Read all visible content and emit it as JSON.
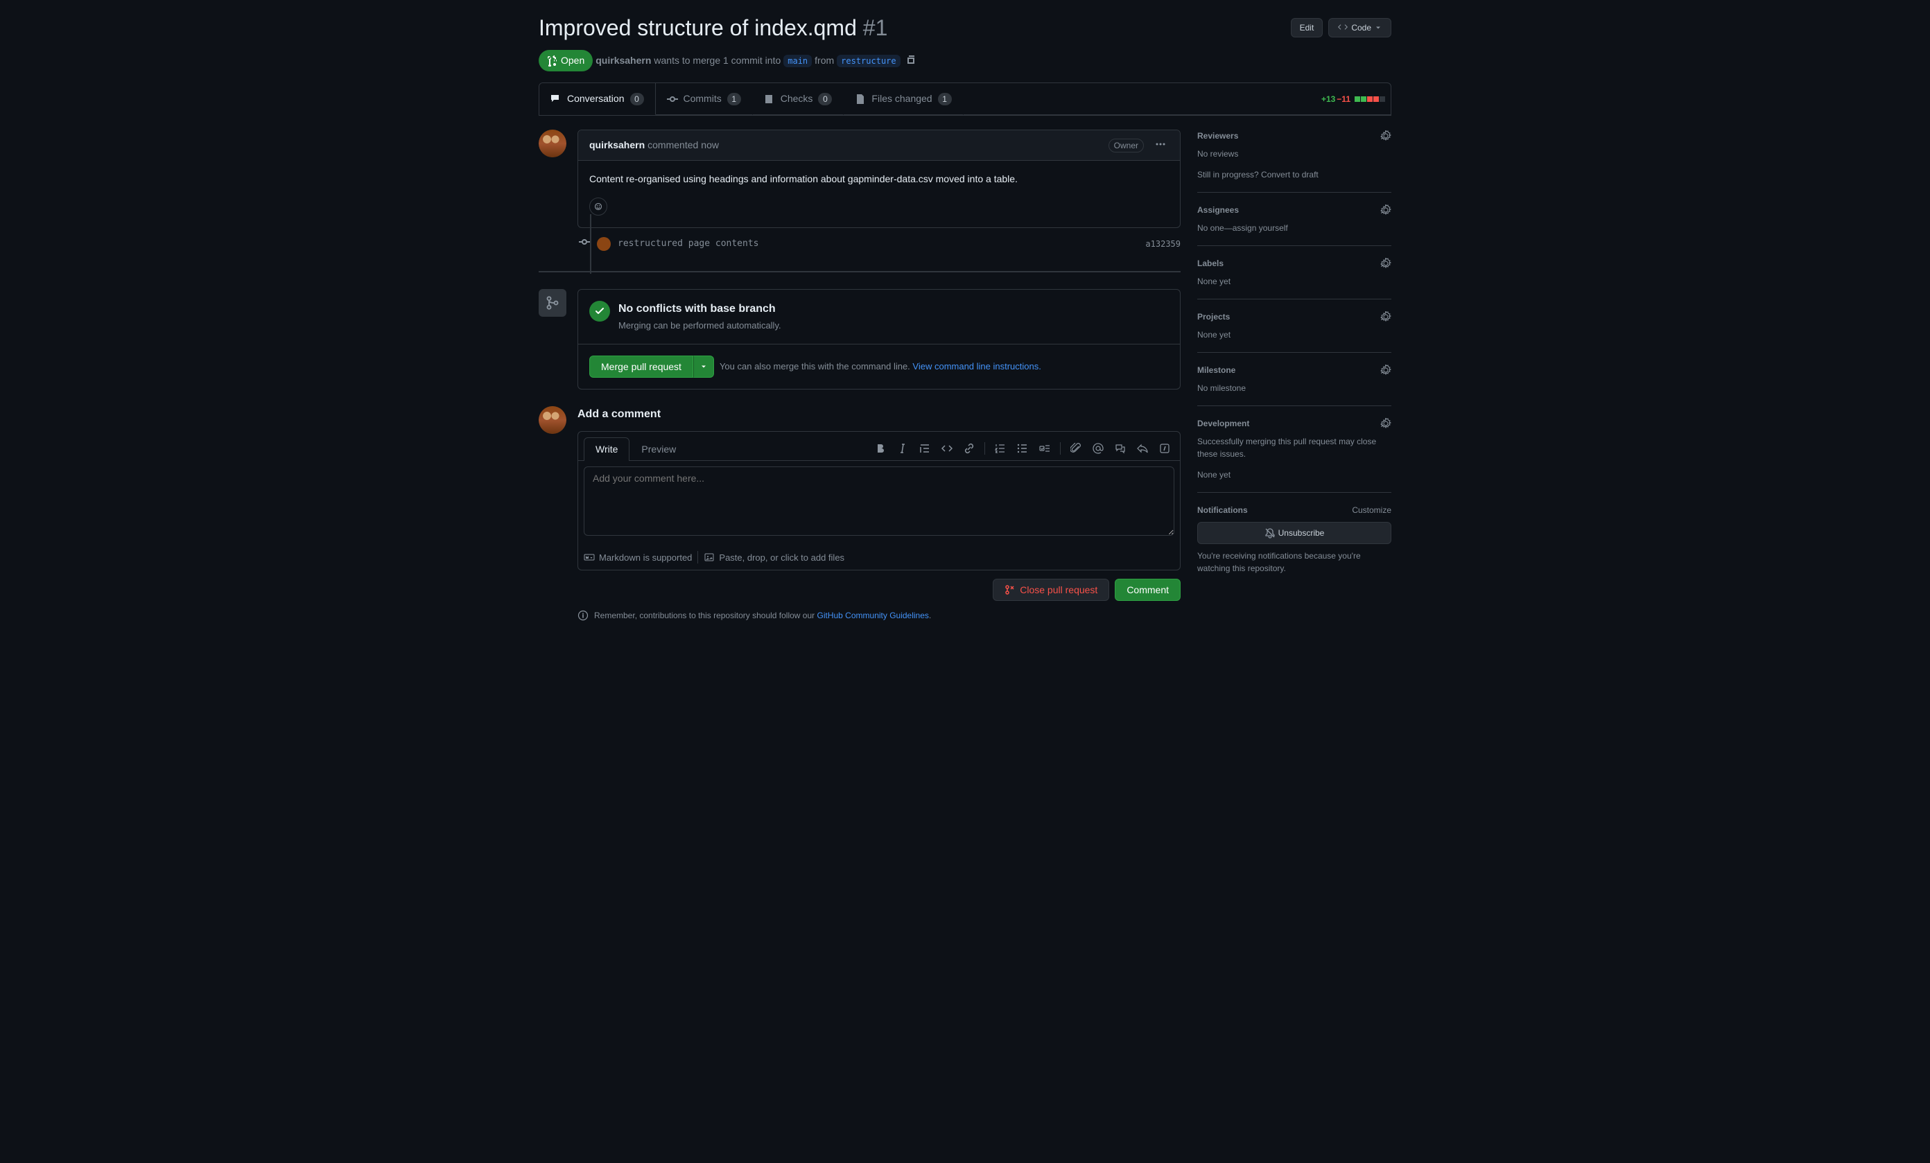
{
  "header": {
    "title": "Improved structure of index.qmd",
    "number": "#1",
    "edit": "Edit",
    "code": "Code",
    "state": "Open",
    "author": "quirksahern",
    "wants": "wants to merge 1 commit into",
    "base": "main",
    "from": "from",
    "compare": "restructure"
  },
  "tabs": {
    "conversation": {
      "label": "Conversation",
      "count": "0"
    },
    "commits": {
      "label": "Commits",
      "count": "1"
    },
    "checks": {
      "label": "Checks",
      "count": "0"
    },
    "files": {
      "label": "Files changed",
      "count": "1"
    }
  },
  "diffstat": {
    "add": "+13",
    "del": "−11"
  },
  "comment": {
    "author": "quirksahern",
    "action": "commented",
    "time": "now",
    "role": "Owner",
    "body": "Content re-organised using headings and information about gapminder-data.csv moved into a table."
  },
  "commit": {
    "msg": "restructured page contents",
    "sha": "a132359"
  },
  "merge": {
    "title": "No conflicts with base branch",
    "subtitle": "Merging can be performed automatically.",
    "button": "Merge pull request",
    "hint_pre": "You can also merge this with the command line. ",
    "hint_link": "View command line instructions."
  },
  "form": {
    "heading": "Add a comment",
    "write": "Write",
    "preview": "Preview",
    "placeholder": "Add your comment here...",
    "markdown": "Markdown is supported",
    "paste": "Paste, drop, or click to add files",
    "close": "Close pull request",
    "comment": "Comment",
    "guidelines_pre": "Remember, contributions to this repository should follow our ",
    "guidelines_link": "GitHub Community Guidelines",
    "guidelines_post": "."
  },
  "sidebar": {
    "reviewers": {
      "title": "Reviewers",
      "body": "No reviews",
      "draft_pre": "Still in progress? ",
      "draft_link": "Convert to draft"
    },
    "assignees": {
      "title": "Assignees",
      "body_pre": "No one—",
      "body_link": "assign yourself"
    },
    "labels": {
      "title": "Labels",
      "body": "None yet"
    },
    "projects": {
      "title": "Projects",
      "body": "None yet"
    },
    "milestone": {
      "title": "Milestone",
      "body": "No milestone"
    },
    "development": {
      "title": "Development",
      "body": "Successfully merging this pull request may close these issues.",
      "none": "None yet"
    },
    "notifications": {
      "title": "Notifications",
      "customize": "Customize",
      "unsubscribe": "Unsubscribe",
      "note": "You're receiving notifications because you're watching this repository."
    }
  }
}
